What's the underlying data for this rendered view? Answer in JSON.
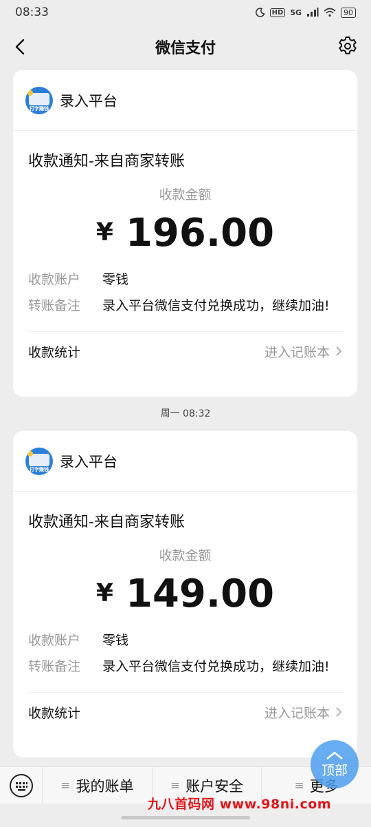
{
  "status": {
    "time": "08:33",
    "hd": "HD",
    "net": "5G",
    "battery": "90"
  },
  "nav": {
    "title": "微信支付"
  },
  "cards": [
    {
      "app_name": "录入平台",
      "logo_text": "打字赚钱",
      "title": "收款通知-来自商家转账",
      "amount_label": "收款金额",
      "currency": "¥",
      "amount": "196.00",
      "account_key": "收款账户",
      "account_value": "零钱",
      "note_key": "转账备注",
      "note_value": "录入平台微信支付兑换成功，继续加油!",
      "stats_label": "收款统计",
      "ledger_link": "进入记账本"
    },
    {
      "app_name": "录入平台",
      "logo_text": "打字赚钱",
      "title": "收款通知-来自商家转账",
      "amount_label": "收款金额",
      "currency": "¥",
      "amount": "149.00",
      "account_key": "收款账户",
      "account_value": "零钱",
      "note_key": "转账备注",
      "note_value": "录入平台微信支付兑换成功，继续加油!",
      "stats_label": "收款统计",
      "ledger_link": "进入记账本"
    }
  ],
  "timestamp": "周一 08:32",
  "fab": {
    "label": "顶部"
  },
  "menu": {
    "items": [
      "我的账单",
      "账户安全",
      "更多"
    ]
  },
  "watermark": "九八首码网 www.98ni.com"
}
